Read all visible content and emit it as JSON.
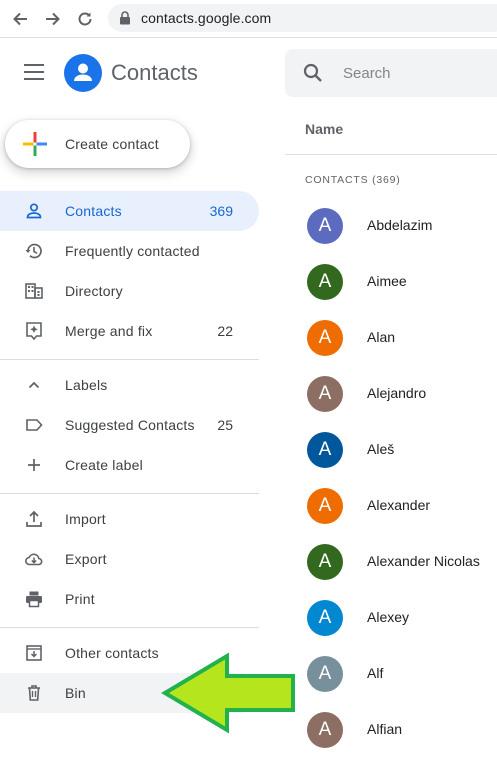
{
  "browser": {
    "url": "contacts.google.com"
  },
  "header": {
    "app_title": "Contacts",
    "search_placeholder": "Search"
  },
  "create_contact": {
    "label": "Create contact"
  },
  "sidebar": {
    "items": [
      {
        "label": "Contacts",
        "count": "369",
        "icon": "person-icon",
        "active": true
      },
      {
        "label": "Frequently contacted",
        "count": "",
        "icon": "history-icon"
      },
      {
        "label": "Directory",
        "count": "",
        "icon": "building-icon"
      },
      {
        "label": "Merge and fix",
        "count": "22",
        "icon": "merge-fix-icon"
      },
      {
        "label": "Labels",
        "count": "",
        "icon": "chevron-up-icon"
      },
      {
        "label": "Suggested Contacts",
        "count": "25",
        "icon": "label-icon"
      },
      {
        "label": "Create label",
        "count": "",
        "icon": "plus-icon"
      },
      {
        "label": "Import",
        "count": "",
        "icon": "upload-icon"
      },
      {
        "label": "Export",
        "count": "",
        "icon": "cloud-download-icon"
      },
      {
        "label": "Print",
        "count": "",
        "icon": "printer-icon"
      },
      {
        "label": "Other contacts",
        "count": "",
        "icon": "archive-download-icon"
      },
      {
        "label": "Bin",
        "count": "",
        "icon": "trash-icon"
      }
    ]
  },
  "main": {
    "column_header": "Name",
    "section_label": "CONTACTS (369)",
    "contacts": [
      {
        "name": "Abdelazim",
        "initial": "A",
        "color": "#5c6bc0"
      },
      {
        "name": "Aimee",
        "initial": "A",
        "color": "#33691e"
      },
      {
        "name": "Alan",
        "initial": "A",
        "color": "#ef6c00"
      },
      {
        "name": "Alejandro",
        "initial": "A",
        "color": "#8d6e63"
      },
      {
        "name": "Aleš",
        "initial": "A",
        "color": "#01579b"
      },
      {
        "name": "Alexander",
        "initial": "A",
        "color": "#ef6c00"
      },
      {
        "name": "Alexander Nicolas",
        "initial": "A",
        "color": "#33691e"
      },
      {
        "name": "Alexey",
        "initial": "A",
        "color": "#0288d1"
      },
      {
        "name": "Alf",
        "initial": "A",
        "color": "#78909c"
      },
      {
        "name": "Alfian",
        "initial": "A",
        "color": "#8d6e63"
      }
    ]
  },
  "colors": {
    "accent": "#1a73e8",
    "active_bg": "#e8f0fe",
    "arrow_fill": "#b5e61d",
    "arrow_stroke": "#22b14c"
  }
}
